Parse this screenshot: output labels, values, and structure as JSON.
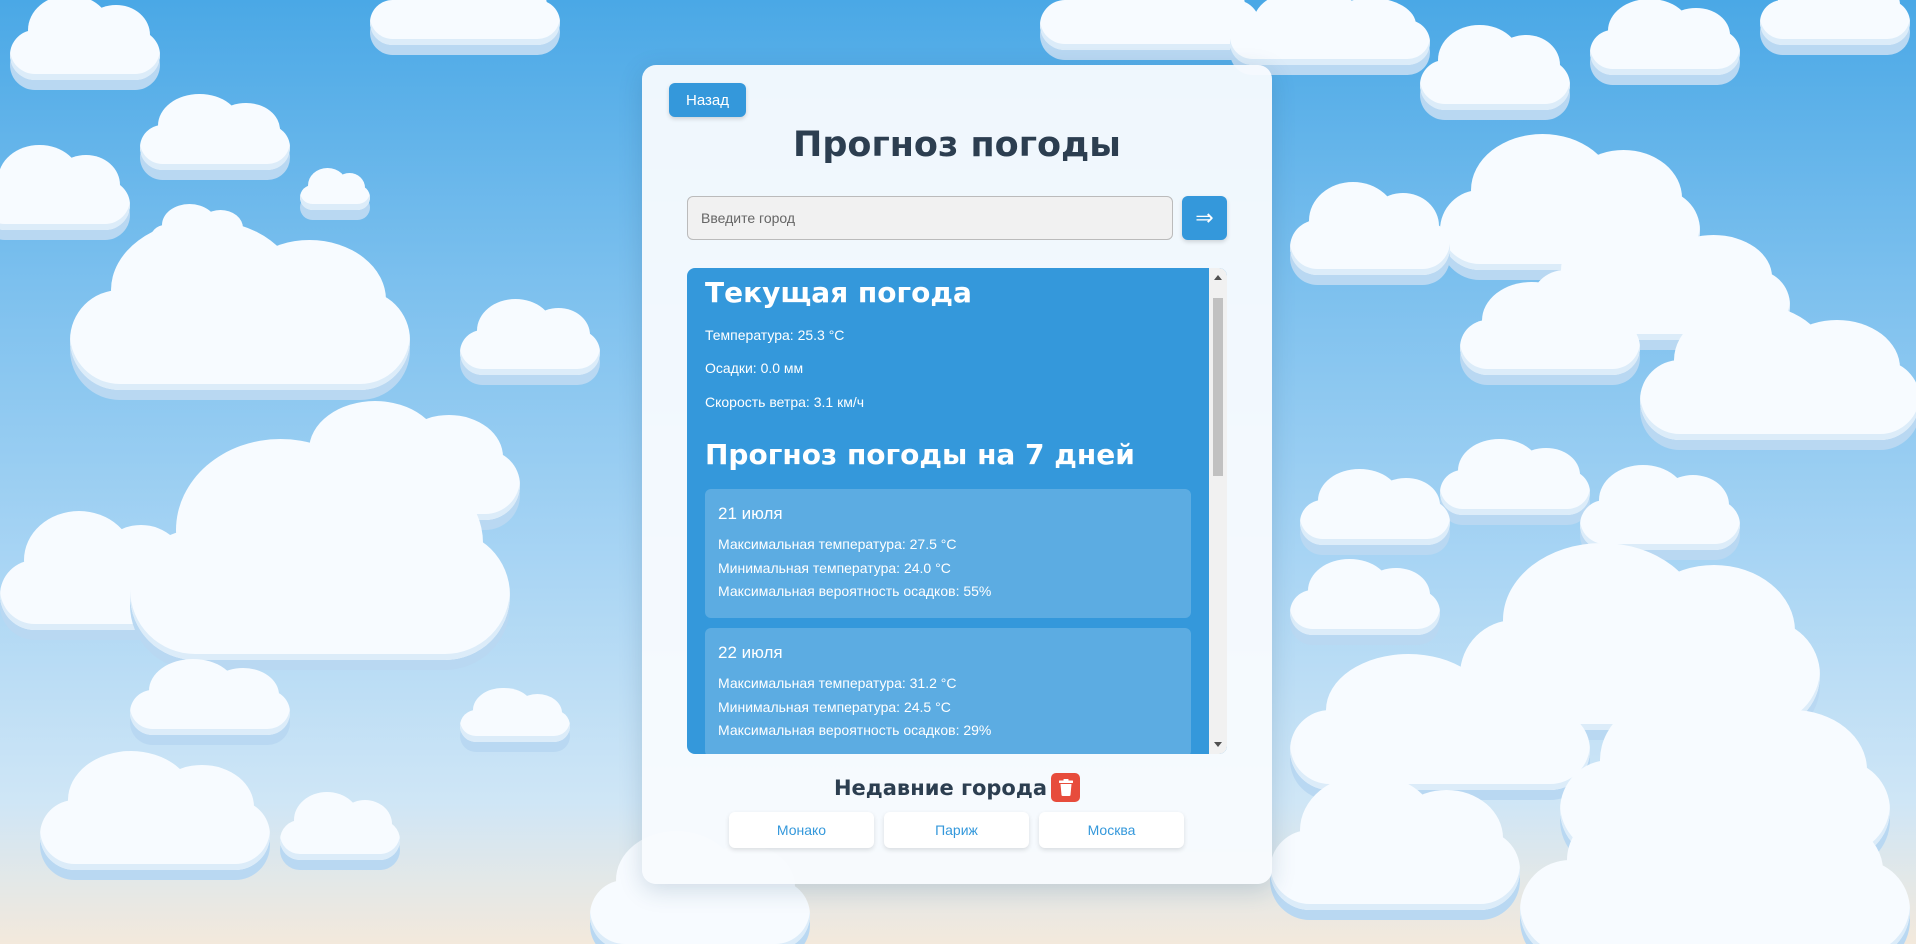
{
  "header": {
    "back_label": "Назад",
    "title": "Прогноз погоды"
  },
  "search": {
    "placeholder": "Введите город",
    "value": "",
    "submit_icon": "arrow-right-icon",
    "submit_glyph": "⇒"
  },
  "current": {
    "heading": "Текущая погода",
    "temperature": "Температура: 25.3 °C",
    "precipitation": "Осадки: 0.0 мм",
    "wind": "Скорость ветра: 3.1 км/ч"
  },
  "forecast": {
    "heading": "Прогноз погоды на 7 дней",
    "days": [
      {
        "date": "21 июля",
        "max_temp": "Максимальная температура: 27.5 °C",
        "min_temp": "Минимальная температура: 24.0 °C",
        "precip_prob": "Максимальная вероятность осадков: 55%"
      },
      {
        "date": "22 июля",
        "max_temp": "Максимальная температура: 31.2 °C",
        "min_temp": "Минимальная температура: 24.5 °C",
        "precip_prob": "Максимальная вероятность осадков: 29%"
      }
    ]
  },
  "recent": {
    "title": "Недавние города",
    "clear_icon": "trash-icon",
    "cities": [
      "Монако",
      "Париж",
      "Москва"
    ]
  },
  "colors": {
    "accent": "#3498db",
    "danger": "#e74c3c",
    "title_text": "#2c3e50"
  }
}
